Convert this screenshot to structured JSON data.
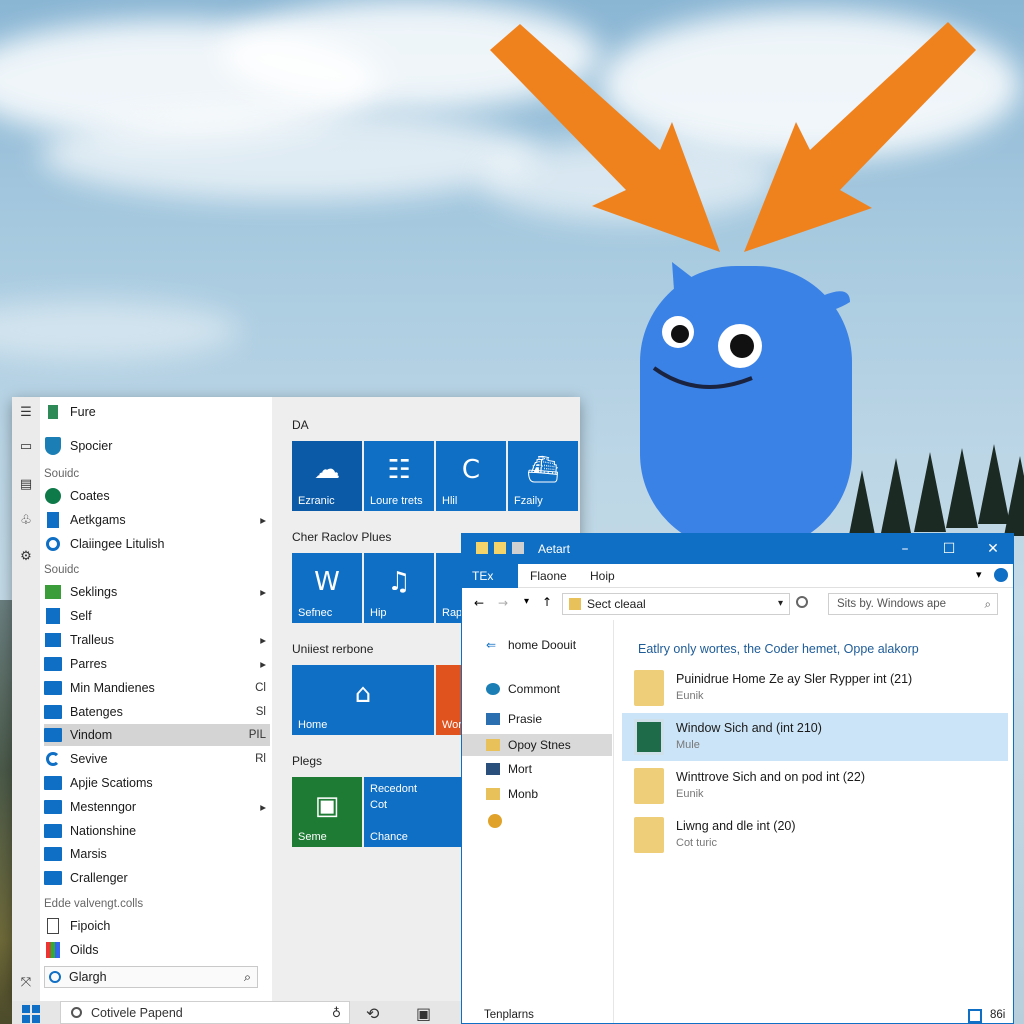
{
  "start_menu": {
    "apps": [
      {
        "label": "Fure",
        "icon": "pin-icon",
        "kind": "app",
        "arrow": false,
        "right": ""
      },
      {
        "label": "Spocier",
        "icon": "shield-icon",
        "kind": "app",
        "arrow": false,
        "right": ""
      },
      {
        "label": "Coates",
        "icon": "xbox-icon",
        "kind": "app",
        "arrow": false,
        "right": ""
      },
      {
        "label": "Aetkgams",
        "icon": "book-icon",
        "kind": "app",
        "arrow": true,
        "right": ""
      },
      {
        "label": "Claiingee Litulish",
        "icon": "search-icon",
        "kind": "app",
        "arrow": false,
        "right": ""
      },
      {
        "label": "Seklings",
        "icon": "map-icon",
        "kind": "app",
        "arrow": true,
        "right": ""
      },
      {
        "label": "Self",
        "icon": "calculator-icon",
        "kind": "app",
        "arrow": false,
        "right": ""
      },
      {
        "label": "Tralleus",
        "icon": "news-icon",
        "kind": "app",
        "arrow": true,
        "right": ""
      },
      {
        "label": "Parres",
        "icon": "folder-icon",
        "kind": "folder",
        "arrow": true,
        "right": ""
      },
      {
        "label": "Min Mandienes",
        "icon": "folder-icon",
        "kind": "folder",
        "arrow": false,
        "right": "Cl"
      },
      {
        "label": "Batenges",
        "icon": "folder-icon",
        "kind": "folder",
        "arrow": false,
        "right": "Sl"
      },
      {
        "label": "Vindom",
        "icon": "folder-icon",
        "kind": "folder",
        "arrow": false,
        "right": "PIL"
      },
      {
        "label": "Sevive",
        "icon": "refresh-icon",
        "kind": "app",
        "arrow": false,
        "right": "Rl"
      },
      {
        "label": "Apjie Scatioms",
        "icon": "folder-icon",
        "kind": "folder",
        "arrow": false,
        "right": ""
      },
      {
        "label": "Mestenngor",
        "icon": "folder-icon",
        "kind": "folder",
        "arrow": true,
        "right": ""
      },
      {
        "label": "Nationshine",
        "icon": "folder-icon",
        "kind": "folder",
        "arrow": false,
        "right": ""
      },
      {
        "label": "Marsis",
        "icon": "folder-icon",
        "kind": "folder",
        "arrow": false,
        "right": ""
      },
      {
        "label": "Crallenger",
        "icon": "folder-icon",
        "kind": "folder",
        "arrow": false,
        "right": ""
      },
      {
        "label": "Fipoich",
        "icon": "document-icon",
        "kind": "app",
        "arrow": false,
        "right": ""
      },
      {
        "label": "Oilds",
        "icon": "paint-icon",
        "kind": "app",
        "arrow": false,
        "right": ""
      }
    ],
    "sections": [
      "Souidc",
      "Souidc",
      "Edde valvengt.colls"
    ],
    "search_text": "Glargh",
    "tile_groups": [
      "DA",
      "Cher Raclov Plues",
      "Uniiest rerbone",
      "Plegs"
    ],
    "tiles": [
      {
        "label": "Ezranic",
        "glyph": "☁",
        "color": "#0a5aa8"
      },
      {
        "label": "Loure trets",
        "glyph": "☷",
        "color": "#0f6fc4"
      },
      {
        "label": "Hlil",
        "glyph": "C",
        "color": "#0f6fc4"
      },
      {
        "label": "Fzaily",
        "glyph": "⛴",
        "color": "#0f6fc4"
      },
      {
        "label": "Sefnec",
        "glyph": "W",
        "color": "#0f6fc4"
      },
      {
        "label": "Hip",
        "glyph": "♫",
        "color": "#0f6fc4"
      },
      {
        "label": "Rap",
        "glyph": "♪",
        "color": "#0f6fc4"
      },
      {
        "label": "Home",
        "glyph": "⌂",
        "color": "#0f6fc4"
      },
      {
        "label": "Woro Conta",
        "glyph": "▦",
        "color": "#e0531e"
      },
      {
        "label": "Seme",
        "glyph": "▣",
        "color": "#1e7b34"
      },
      {
        "label": "Chance",
        "glyph": "",
        "color": "#0f6fc4",
        "top_text": "Recedont",
        "mid_text": "Cot"
      }
    ]
  },
  "taskbar": {
    "search_placeholder": "Cotivele Papend"
  },
  "explorer": {
    "title": "Aetart",
    "ribbon_tabs": [
      "TEx",
      "Flaone",
      "Hoip"
    ],
    "address": "Sect cleaal",
    "search_placeholder": "Sits by. Windows ape",
    "nav_items": [
      {
        "label": "home Doouit",
        "icon": "back-arrow-icon",
        "selected": false
      },
      {
        "label": "Commont",
        "icon": "people-icon",
        "selected": false
      },
      {
        "label": "Prasie",
        "icon": "image-icon",
        "selected": false
      },
      {
        "label": "Opoy Stnes",
        "icon": "folder-icon",
        "selected": true
      },
      {
        "label": "Mort",
        "icon": "drive-icon",
        "selected": false
      },
      {
        "label": "Monb",
        "icon": "folder-icon",
        "selected": false
      }
    ],
    "content_header": "Eatlry only wortes, the Coder hemet, Oppe alakorp",
    "files": [
      {
        "name": "Puinidrue Home Ze ay Sler Rypper int (21)",
        "sub": "Eunik",
        "selected": false,
        "icon": "folder-icon"
      },
      {
        "name": "Window Sich and (int 210)",
        "sub": "Mule",
        "selected": true,
        "icon": "app-icon"
      },
      {
        "name": "Winttrove Sich and on pod int (22)",
        "sub": "Eunik",
        "selected": false,
        "icon": "folder-icon"
      },
      {
        "name": "Liwng and dle int (20)",
        "sub": "Cot turic",
        "selected": false,
        "icon": "folder-icon"
      }
    ],
    "status_left": "Tenplarns",
    "status_right": "86i"
  },
  "colors": {
    "accent": "#0f6fc4",
    "arrow": "#f0821e",
    "mascot": "#3b82e6"
  }
}
